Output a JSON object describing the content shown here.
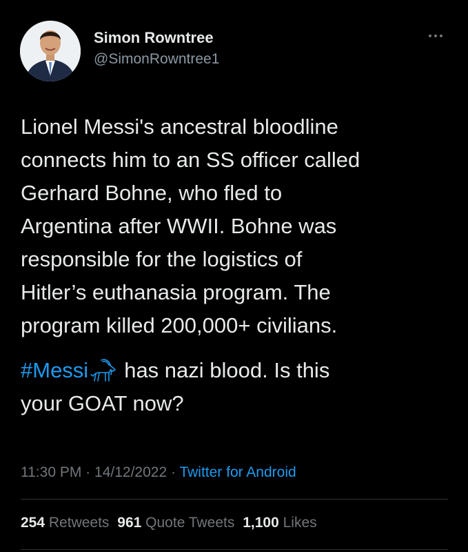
{
  "author": {
    "display_name": "Simon Rowntree",
    "handle": "@SimonRowntree1"
  },
  "tweet": {
    "lines": [
      "Lionel Messi's ancestral bloodline",
      "connects him to an SS officer called",
      "Gerhard Bohne, who fled to",
      "Argentina after WWII. Bohne was",
      "responsible for the logistics of",
      "Hitler’s euthanasia program. The",
      "program killed 200,000+ civilians."
    ],
    "hashtag": "#Messi",
    "hashtag_emoji": "goat-emoji-icon",
    "line_after_hashtag": "has nazi blood. Is this",
    "last_line": "your GOAT now?"
  },
  "meta": {
    "time": "11:30 PM",
    "separator": "·",
    "date": "14/12/2022",
    "source": "Twitter for Android"
  },
  "stats": {
    "retweets_count": "254",
    "retweets_label": "Retweets",
    "quote_tweets_count": "961",
    "quote_tweets_label": "Quote Tweets",
    "likes_count": "1,100",
    "likes_label": "Likes"
  },
  "colors": {
    "background": "#000000",
    "text": "#e7e9ea",
    "secondary": "#71767b",
    "link": "#1d9bf0",
    "divider": "#2f3336"
  }
}
